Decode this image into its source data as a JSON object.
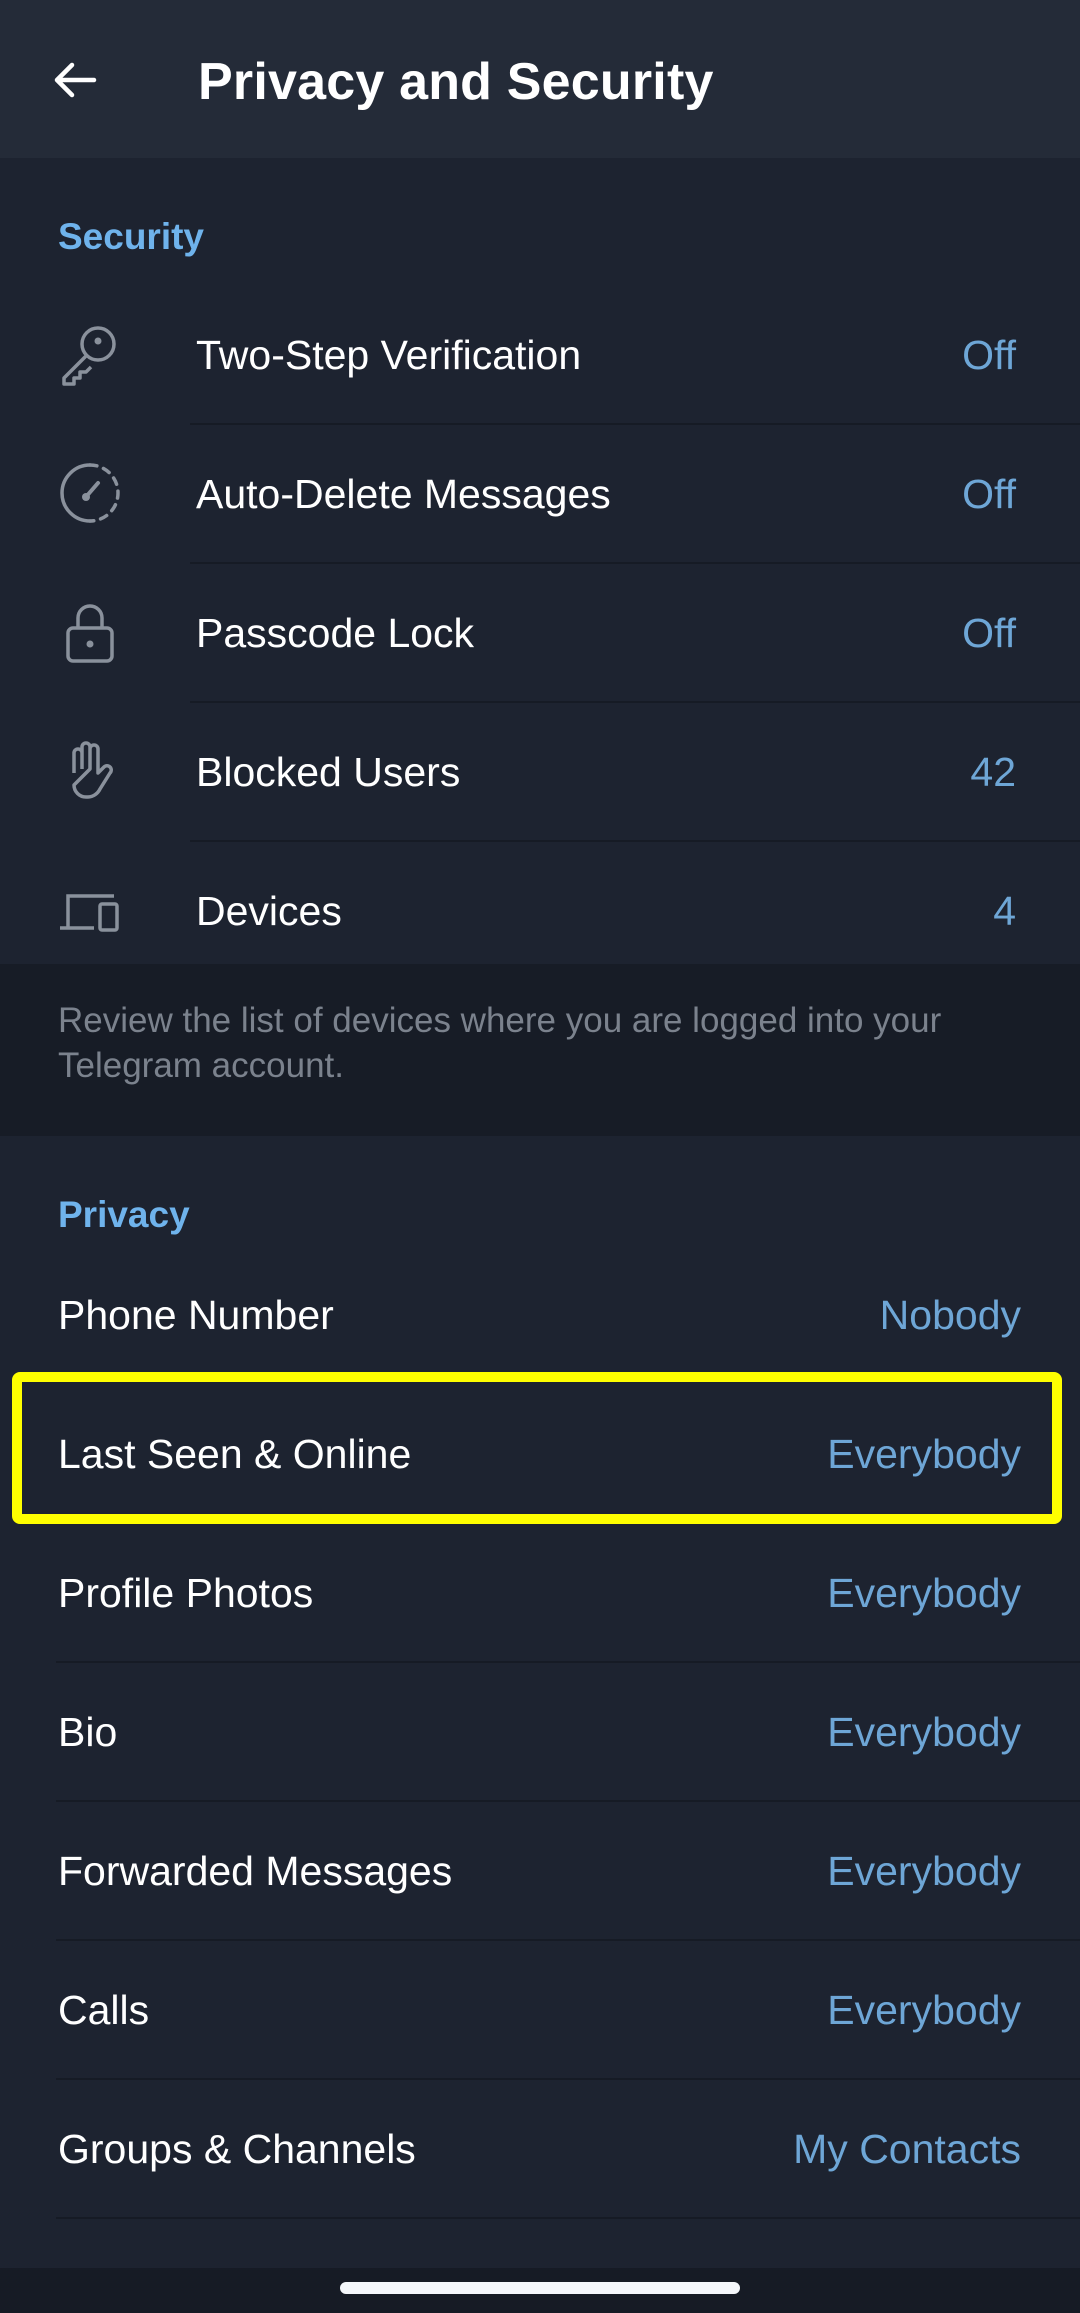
{
  "header": {
    "title": "Privacy and Security",
    "back_icon": "arrow-left-icon"
  },
  "security": {
    "title": "Security",
    "items": [
      {
        "label": "Two-Step Verification",
        "value": "Off",
        "icon": "key-icon"
      },
      {
        "label": "Auto-Delete Messages",
        "value": "Off",
        "icon": "timer-icon"
      },
      {
        "label": "Passcode Lock",
        "value": "Off",
        "icon": "lock-icon"
      },
      {
        "label": "Blocked Users",
        "value": "42",
        "icon": "hand-icon"
      },
      {
        "label": "Devices",
        "value": "4",
        "icon": "devices-icon"
      }
    ],
    "info": "Review the list of devices where you are logged into your Telegram account."
  },
  "privacy": {
    "title": "Privacy",
    "items": [
      {
        "label": "Phone Number",
        "value": "Nobody"
      },
      {
        "label": "Last Seen & Online",
        "value": "Everybody",
        "highlighted": true
      },
      {
        "label": "Profile Photos",
        "value": "Everybody"
      },
      {
        "label": "Bio",
        "value": "Everybody"
      },
      {
        "label": "Forwarded Messages",
        "value": "Everybody"
      },
      {
        "label": "Calls",
        "value": "Everybody"
      },
      {
        "label": "Groups & Channels",
        "value": "My Contacts"
      }
    ]
  },
  "colors": {
    "accent": "#6fb3ec",
    "value": "#6ea6d6",
    "background": "#1d2330",
    "header": "#242b38",
    "highlight": "#ffff00"
  }
}
